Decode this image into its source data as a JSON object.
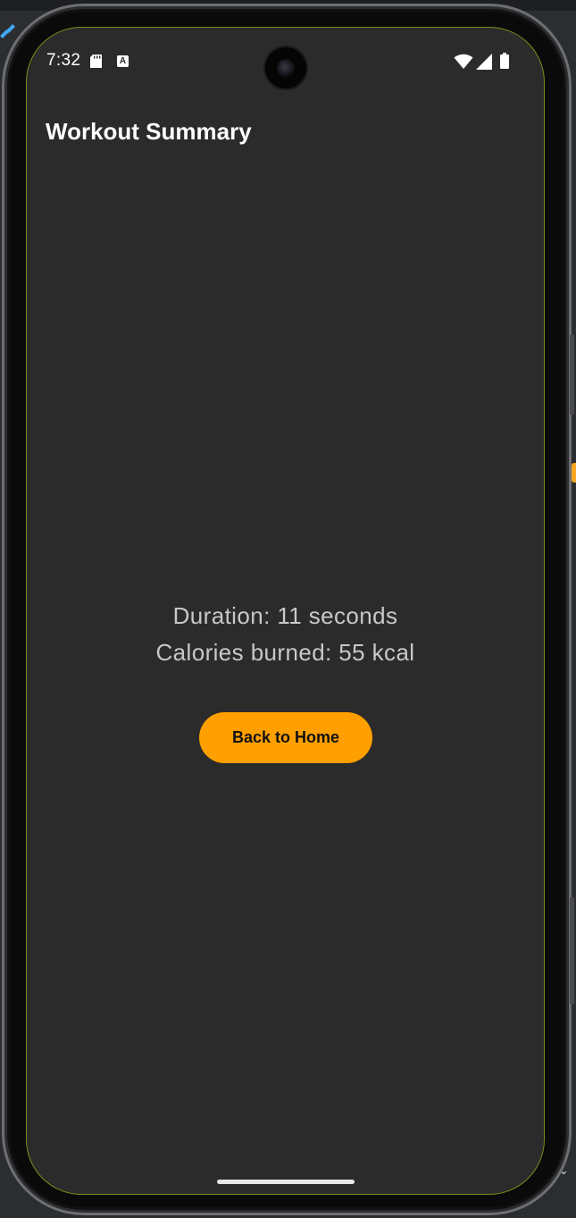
{
  "status_bar": {
    "time": "7:32",
    "icons": [
      "sd-card-icon",
      "a-keyboard-icon",
      "wifi-icon",
      "signal-icon",
      "battery-icon"
    ],
    "a_icon_letter": "A"
  },
  "app_bar": {
    "title": "Workout Summary"
  },
  "summary": {
    "duration": "Duration: 11 seconds",
    "calories": "Calories burned: 55 kcal"
  },
  "actions": {
    "back_label": "Back to Home"
  },
  "colors": {
    "background": "#2b2b2b",
    "accent": "#ffa000",
    "text_primary": "#ffffff",
    "text_secondary": "#c8c8c8"
  }
}
